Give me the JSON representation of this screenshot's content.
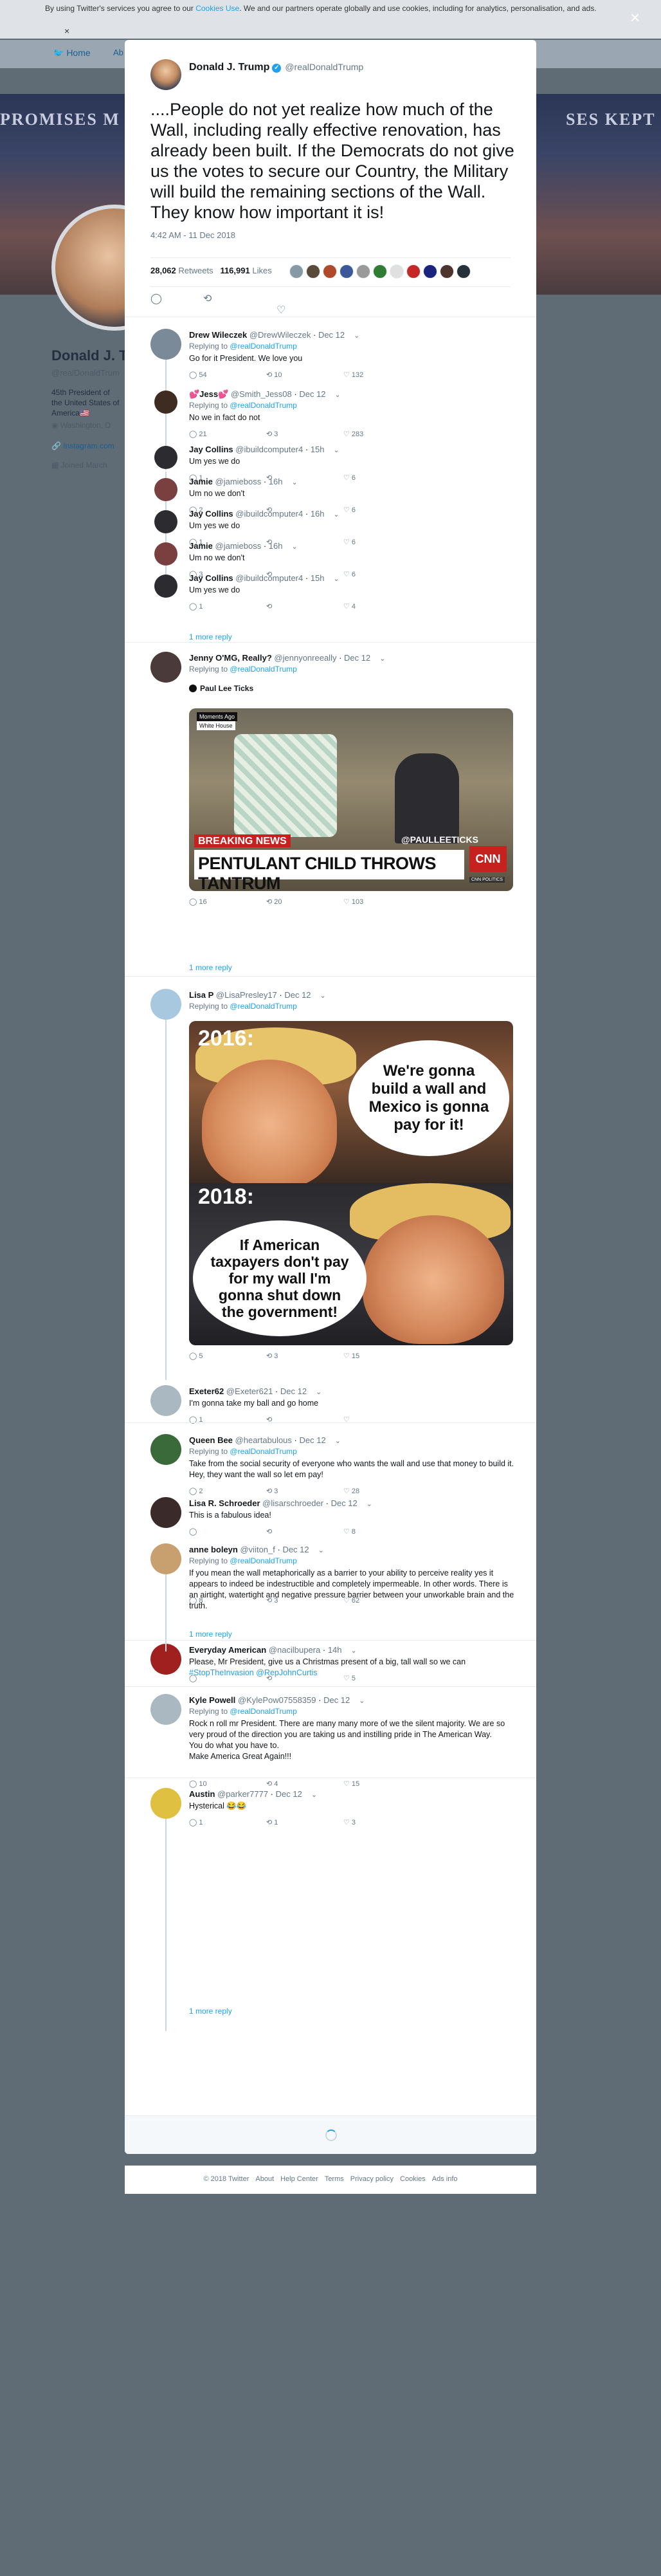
{
  "cookie": {
    "text1": "By using Twitter's services you agree to our",
    "link": "Cookies Use",
    "text2": ". We and our partners operate globally and use cookies, including for analytics, personalisation, and ads.",
    "close": "×"
  },
  "nav": {
    "bird": "🐦 Home",
    "more": "Ab"
  },
  "banner": {
    "left": "PROMISES M",
    "right": "SES KEPT"
  },
  "profile": {
    "name": "Donald J. T",
    "handle": "@realDonaldTrum",
    "bio": "45th President of the United States of America🇺🇸",
    "location": "Washington, D",
    "website": "Instagram.com",
    "joined": "Joined March"
  },
  "modal_close": "×",
  "main": {
    "name": "Donald J. Trump",
    "handle": "@realDonaldTrump",
    "text": "....People do not yet realize how much of the Wall, including really effective renovation, has already been built. If the Democrats do not give us the votes to secure our Country, the Military will build the remaining sections of the Wall. They know how important it is!",
    "time": "4:42 AM - 11 Dec 2018",
    "retweets": "28,062",
    "retweets_label": "Retweets",
    "likes": "116,991",
    "likes_label": "Likes",
    "liker_colors": [
      "#8899a6",
      "#5a4a3a",
      "#b04a2a",
      "#3b5998",
      "#9a9a9a",
      "#2e7d32",
      "#e0e0e0",
      "#c62828",
      "#1a237e",
      "#4e342e",
      "#263238"
    ]
  },
  "replies": [
    {
      "name": "Drew Wileczek",
      "handle": "@DrewWileczek",
      "date": "Dec 12",
      "replyto": "@realDonaldTrump",
      "text": "Go for it President. We love you",
      "r": "54",
      "rt": "10",
      "l": "132",
      "color": "#7b8a98"
    },
    {
      "name": "💕Jess💕",
      "handle": "@Smith_Jess08",
      "date": "Dec 12",
      "replyto": "@realDonaldTrump",
      "text": "No we in fact do not",
      "r": "21",
      "rt": "3",
      "l": "283",
      "color": "#3e2b22"
    },
    {
      "name": "Jay Collins",
      "handle": "@ibuildcomputer4",
      "date": "15h",
      "text": "Um yes we do",
      "r": "1",
      "rt": "",
      "l": "6",
      "color": "#2b2b30"
    },
    {
      "name": "Jamie",
      "handle": "@jamieboss",
      "date": "16h",
      "text": "Um no we don't",
      "r": "2",
      "rt": "",
      "l": "6",
      "color": "#7a4040"
    },
    {
      "name": "Jay Collins",
      "handle": "@ibuildcomputer4",
      "date": "16h",
      "text": "Um yes we do",
      "r": "1",
      "rt": "",
      "l": "6",
      "color": "#2b2b30"
    },
    {
      "name": "Jamie",
      "handle": "@jamieboss",
      "date": "16h",
      "text": "Um no we don't",
      "r": "3",
      "rt": "",
      "l": "6",
      "color": "#7a4040"
    },
    {
      "name": "Jay Collins",
      "handle": "@ibuildcomputer4",
      "date": "15h",
      "text": "Um yes we do",
      "r": "1",
      "rt": "",
      "l": "4",
      "color": "#2b2b30"
    },
    {
      "name": "Jenny O'MG, Really?",
      "handle": "@jennyonreeally",
      "date": "Dec 12",
      "replyto": "@realDonaldTrump",
      "quote": "Paul Lee Ticks",
      "r": "16",
      "rt": "20",
      "l": "103",
      "color": "#4a3a3a"
    },
    {
      "name": "Lisa P",
      "handle": "@LisaPresley17",
      "date": "Dec 12",
      "replyto": "@realDonaldTrump",
      "r": "5",
      "rt": "3",
      "l": "15",
      "color": "#a8c8e0"
    },
    {
      "name": "Exeter62",
      "handle": "@Exeter621",
      "date": "Dec 12",
      "text": "I'm gonna take my ball and go home",
      "r": "1",
      "rt": "",
      "l": "",
      "color": "#aab8c2"
    },
    {
      "name": "Queen Bee",
      "handle": "@heartabulous",
      "date": "Dec 12",
      "replyto": "@realDonaldTrump",
      "text": "Take from the social security of everyone who wants the wall and use that money to  build it. Hey, they want the wall so let em pay!",
      "r": "2",
      "rt": "3",
      "l": "28",
      "color": "#3a6a3a"
    },
    {
      "name": "Lisa R. Schroeder",
      "handle": "@lisarschroeder",
      "date": "Dec 12",
      "text": "This is a fabulous idea!",
      "r": "",
      "rt": "",
      "l": "8",
      "color": "#3a2a2a"
    },
    {
      "name": "anne boleyn",
      "handle": "@viiton_f",
      "date": "Dec 12",
      "replyto": "@realDonaldTrump",
      "text": "If you mean the wall metaphorically as a barrier to your ability to perceive reality yes it appears to indeed be indestructible and completely impermeable. In other words. There is an airtight, watertight and negative pressure barrier between your unworkable brain and the truth.",
      "r": "8",
      "rt": "3",
      "l": "62",
      "color": "#c8a070"
    },
    {
      "name": "Everyday American",
      "handle": "@nacilbupera",
      "date": "14h",
      "text": "Please, Mr President, give us a Christmas present of a big, tall wall so we can",
      "link": "#StopTheInvasion @RepJohnCurtis",
      "r": "",
      "rt": "",
      "l": "5",
      "color": "#a02020"
    },
    {
      "name": "Kyle Powell",
      "handle": "@KylePow07558359",
      "date": "Dec 12",
      "replyto": "@realDonaldTrump",
      "text": "Rock n roll mr President. There are many many more of we the silent majority. We are so very proud of the direction you are taking us and instilling pride in The American Way.",
      "text2": "You do what you have to.",
      "text3": "Make America Great Again!!!",
      "r": "10",
      "rt": "4",
      "l": "15",
      "color": "#aab8c2"
    },
    {
      "name": "Austin",
      "handle": "@parker7777",
      "date": "Dec 12",
      "text": "Hysterical 😂😂",
      "r": "1",
      "rt": "1",
      "l": "3",
      "color": "#e0c040"
    }
  ],
  "more_reply": "1 more reply",
  "replying_to": "Replying to",
  "tantrum": {
    "moments": "Moments Ago",
    "whitehouse": "White House",
    "breaking": "BREAKING NEWS",
    "handle": "@PAULLEETICKS",
    "headline": "PENTULANT CHILD THROWS TANTRUM",
    "cnn": "CNN",
    "live": "CNN POLITICS"
  },
  "wall": {
    "year1": "2016:",
    "bubble1": "We're gonna build a wall and Mexico is gonna pay for it!",
    "year2": "2018:",
    "bubble2": "If American taxpayers don't pay for my wall I'm gonna shut down the government!"
  },
  "footer": [
    "© 2018 Twitter",
    "About",
    "Help Center",
    "Terms",
    "Privacy policy",
    "Cookies",
    "Ads info"
  ]
}
